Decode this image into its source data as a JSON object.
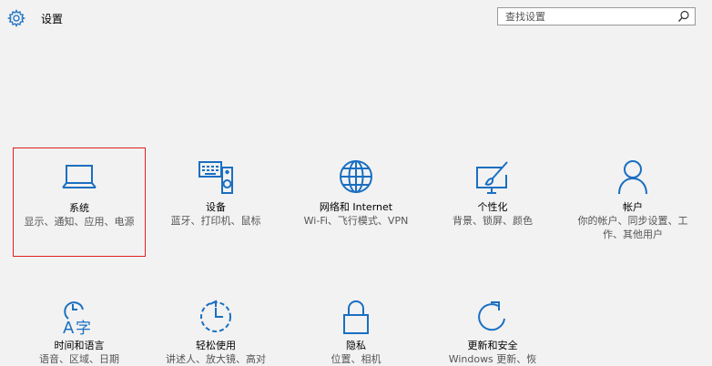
{
  "header": {
    "title": "设置",
    "search_placeholder": "查找设置"
  },
  "tiles": [
    {
      "name": "系统",
      "desc": "显示、通知、应用、电源",
      "icon": "laptop-icon"
    },
    {
      "name": "设备",
      "desc": "蓝牙、打印机、鼠标",
      "icon": "devices-icon"
    },
    {
      "name": "网络和 Internet",
      "desc": "Wi-Fi、飞行模式、VPN",
      "icon": "globe-icon"
    },
    {
      "name": "个性化",
      "desc": "背景、锁屏、颜色",
      "icon": "personalization-icon"
    },
    {
      "name": "帐户",
      "desc": "你的帐户、同步设置、工作、其他用户",
      "icon": "person-icon"
    },
    {
      "name": "时间和语言",
      "desc": "语音、区域、日期",
      "icon": "time-language-icon"
    },
    {
      "name": "轻松使用",
      "desc": "讲述人、放大镜、高对",
      "icon": "ease-of-access-icon"
    },
    {
      "name": "隐私",
      "desc": "位置、相机",
      "icon": "lock-icon"
    },
    {
      "name": "更新和安全",
      "desc": "Windows 更新、恢",
      "icon": "update-icon"
    }
  ],
  "colors": {
    "accent": "#1a6fc1",
    "selection": "#e02020"
  }
}
